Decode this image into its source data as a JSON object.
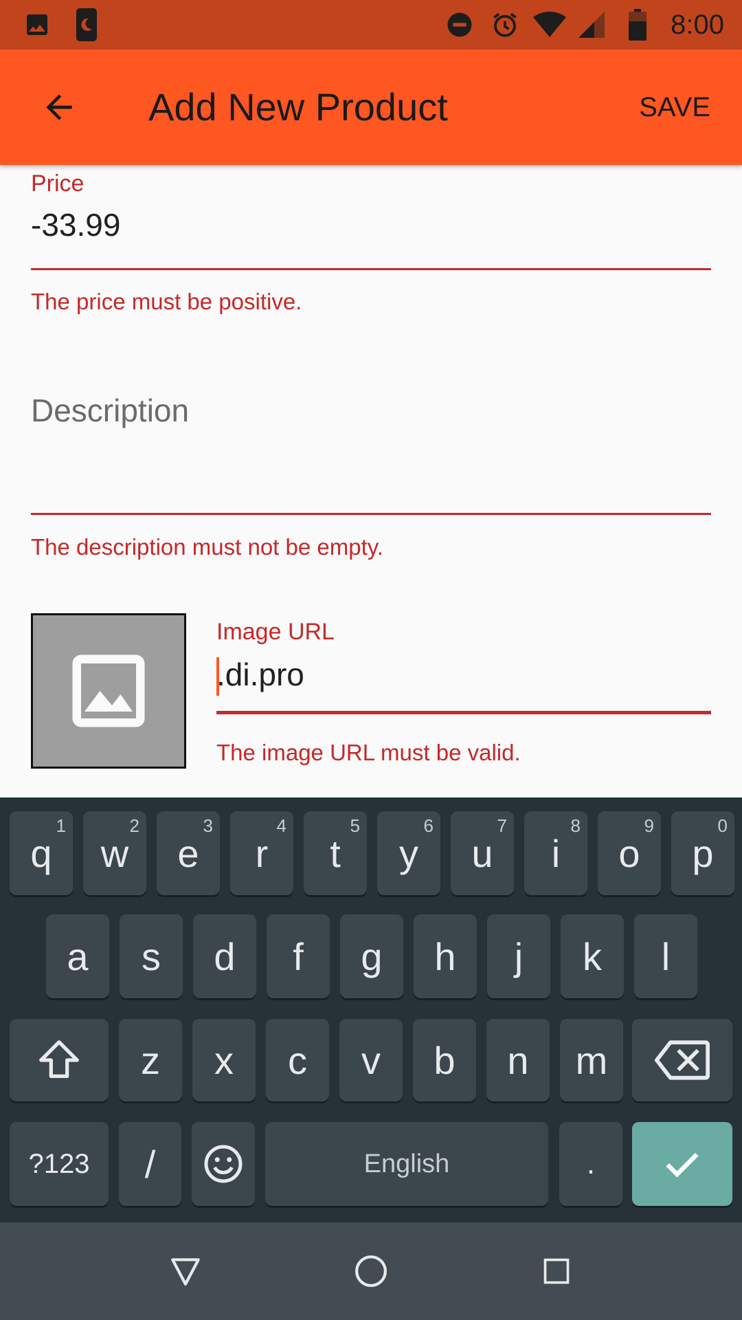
{
  "status_bar": {
    "time": "8:00",
    "left_icons": [
      "image-icon",
      "night-mode-icon"
    ],
    "right_icons": [
      "do-not-disturb-icon",
      "alarm-icon",
      "wifi-icon",
      "cell-signal-icon",
      "battery-icon"
    ]
  },
  "app_bar": {
    "title": "Add New Product",
    "save_label": "SAVE",
    "back_icon": "arrow-back-icon"
  },
  "form": {
    "price": {
      "label": "Price",
      "value": "-33.99",
      "error": "The price must be positive."
    },
    "description": {
      "placeholder": "Description",
      "value": "",
      "error": "The description must not be empty."
    },
    "image_url": {
      "label": "Image URL",
      "value": ".di.pro",
      "error": "The image URL must be valid."
    }
  },
  "keyboard": {
    "row1": [
      {
        "key": "q",
        "hint": "1"
      },
      {
        "key": "w",
        "hint": "2"
      },
      {
        "key": "e",
        "hint": "3"
      },
      {
        "key": "r",
        "hint": "4"
      },
      {
        "key": "t",
        "hint": "5"
      },
      {
        "key": "y",
        "hint": "6"
      },
      {
        "key": "u",
        "hint": "7"
      },
      {
        "key": "i",
        "hint": "8"
      },
      {
        "key": "o",
        "hint": "9"
      },
      {
        "key": "p",
        "hint": "0"
      }
    ],
    "row2": [
      "a",
      "s",
      "d",
      "f",
      "g",
      "h",
      "j",
      "k",
      "l"
    ],
    "row3": [
      "z",
      "x",
      "c",
      "v",
      "b",
      "n",
      "m"
    ],
    "symbols_label": "?123",
    "slash_label": "/",
    "space_label": "English",
    "period_label": "."
  },
  "colors": {
    "status_bar": "#c2441d",
    "app_bar": "#ff5722",
    "error": "#c62828",
    "keyboard_bg": "#263238",
    "key_bg": "#3b464d",
    "enter_key": "#6aaca4",
    "nav_bar": "#434c53"
  }
}
